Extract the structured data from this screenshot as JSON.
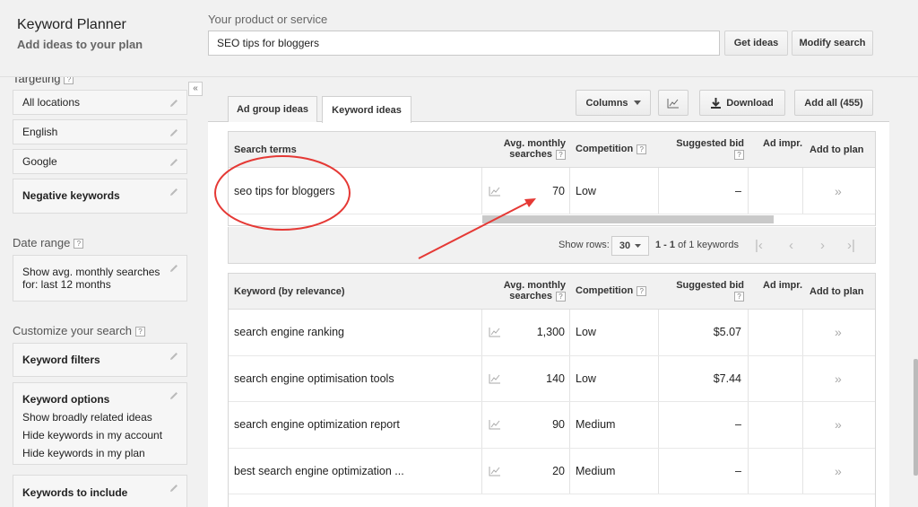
{
  "app": {
    "title": "Keyword Planner",
    "subtitle": "Add ideas to your plan"
  },
  "search": {
    "label": "Your product or service",
    "value": "SEO tips for bloggers",
    "get_ideas": "Get ideas",
    "modify": "Modify search"
  },
  "sidebar": {
    "targeting_label": "Targeting",
    "locations": "All locations",
    "language": "English",
    "network": "Google",
    "negative": "Negative keywords",
    "date_range_label": "Date range",
    "date_range_lines": [
      "Show avg. monthly searches",
      "for: last 12 months"
    ],
    "customize_label": "Customize your search",
    "keyword_filters": "Keyword filters",
    "keyword_options": "Keyword options",
    "keyword_options_lines": [
      "Show broadly related ideas",
      "Hide keywords in my account",
      "Hide keywords in my plan"
    ],
    "keywords_to_include": "Keywords to include",
    "collapse": "«"
  },
  "tabs": {
    "ad_group": "Ad group ideas",
    "keyword": "Keyword ideas"
  },
  "toolbar": {
    "columns": "Columns",
    "download": "Download",
    "add_all": "Add all (455)"
  },
  "columns": {
    "search_terms": "Search terms",
    "keyword_by_relevance": "Keyword (by relevance)",
    "avg_monthly_1": "Avg. monthly",
    "avg_monthly_2": "searches",
    "competition": "Competition",
    "suggested_bid": "Suggested bid",
    "ad_impr": "Ad impr.",
    "add_to_plan": "Add to plan",
    "help": "?"
  },
  "search_terms_row": {
    "keyword": "seo tips for bloggers",
    "searches": "70",
    "competition": "Low",
    "bid": "–"
  },
  "pager": {
    "show_rows_label": "Show rows:",
    "rows": "30",
    "range": "1 - 1",
    "of_text": "of 1 keywords"
  },
  "keyword_rows": [
    {
      "keyword": "search engine ranking",
      "searches": "1,300",
      "competition": "Low",
      "bid": "$5.07"
    },
    {
      "keyword": "search engine optimisation tools",
      "searches": "140",
      "competition": "Low",
      "bid": "$7.44"
    },
    {
      "keyword": "search engine optimization report",
      "searches": "90",
      "competition": "Medium",
      "bid": "–"
    },
    {
      "keyword": "best search engine optimization ...",
      "searches": "20",
      "competition": "Medium",
      "bid": "–"
    }
  ],
  "add_chevron": "»",
  "colors": {
    "annotation": "#e53935",
    "border": "#d6d6d6",
    "header_bg": "#f1f1f1"
  }
}
